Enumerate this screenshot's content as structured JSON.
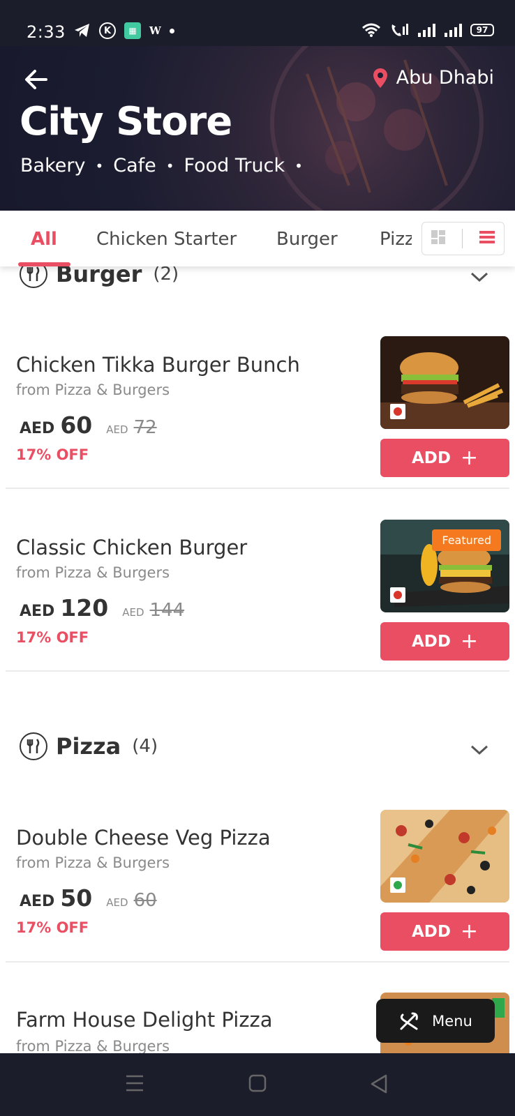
{
  "status_bar": {
    "time": "2:33",
    "battery": "97",
    "icons_left": [
      "telegram-icon",
      "k-icon",
      "app-icon",
      "w-icon",
      "dot-icon"
    ],
    "icons_right": [
      "wifi-icon",
      "volte-icon",
      "signal-icon",
      "signal-icon",
      "battery-icon"
    ],
    "k_label": "K",
    "w_label": "W"
  },
  "header": {
    "location": "Abu Dhabi",
    "title": "City Store",
    "tags": [
      "Bakery",
      "Cafe",
      "Food Truck"
    ],
    "tag_separator": "•"
  },
  "tabs": {
    "items": [
      "All",
      "Chicken Starter",
      "Burger",
      "Pizza"
    ],
    "active": "All"
  },
  "sections": [
    {
      "title": "Burger",
      "count": "(2)",
      "items": [
        {
          "name": "Chicken Tikka Burger Bunch",
          "from": "from Pizza & Burgers",
          "currency": "AED",
          "price": "60",
          "old_currency": "AED",
          "old_price": "72",
          "off": "17% OFF",
          "veg": false,
          "featured": null,
          "add_label": "ADD"
        },
        {
          "name": "Classic Chicken Burger",
          "from": "from Pizza & Burgers",
          "currency": "AED",
          "price": "120",
          "old_currency": "AED",
          "old_price": "144",
          "off": "17% OFF",
          "veg": false,
          "featured": "Featured",
          "add_label": "ADD"
        }
      ]
    },
    {
      "title": "Pizza",
      "count": "(4)",
      "items": [
        {
          "name": "Double Cheese Veg Pizza",
          "from": "from Pizza & Burgers",
          "currency": "AED",
          "price": "50",
          "old_currency": "AED",
          "old_price": "60",
          "off": "17% OFF",
          "veg": true,
          "featured": null,
          "add_label": "ADD"
        },
        {
          "name": "Farm House Delight Pizza",
          "from": "from Pizza & Burgers"
        }
      ]
    }
  ],
  "menu_button": {
    "label": "Menu"
  },
  "colors": {
    "accent": "#e94e62",
    "featured": "#f57a1f",
    "header_bg": "#1b1c30",
    "nonveg": "#d9362b",
    "veg": "#2ea84a"
  }
}
